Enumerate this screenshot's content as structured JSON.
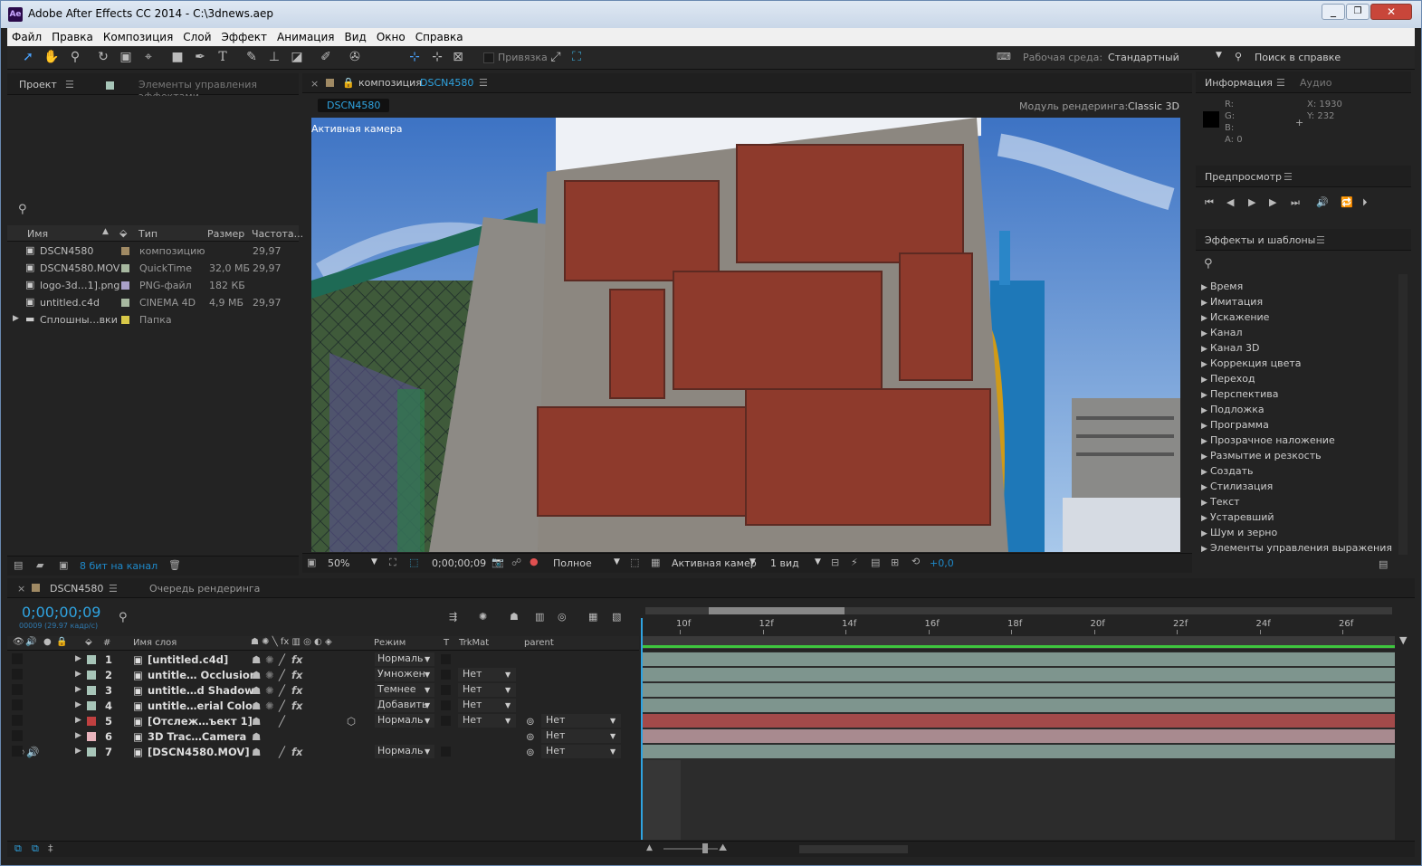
{
  "app": {
    "title": "Adobe After Effects CC 2014 - C:\\3dnews.aep",
    "logo": "Ae"
  },
  "menu": [
    "Файл",
    "Правка",
    "Композиция",
    "Слой",
    "Эффект",
    "Анимация",
    "Вид",
    "Окно",
    "Справка"
  ],
  "toolbar": {
    "snap_label": "Привязка",
    "workspace_label": "Рабочая среда:",
    "workspace_value": "Стандартный",
    "help_search": "Поиск в справке"
  },
  "project": {
    "tab": "Проект",
    "tab2": "Элементы управления эффектами",
    "columns": [
      "Имя",
      "Тип",
      "Размер",
      "Частота..."
    ],
    "items": [
      {
        "name": "DSCN4580",
        "type": "композицию",
        "size": "",
        "rate": "29,97",
        "color": "#a08a64"
      },
      {
        "name": "DSCN4580.MOV",
        "type": "QuickTime",
        "size": "32,0 МБ",
        "rate": "29,97",
        "color": "#a7b8a0"
      },
      {
        "name": "logo-3d…1].png",
        "type": "PNG-файл",
        "size": "182 КБ",
        "rate": "",
        "color": "#a8a0c8"
      },
      {
        "name": "untitled.c4d",
        "type": "CINEMA 4D",
        "size": "4,9 МБ",
        "rate": "29,97",
        "color": "#a7b8a0"
      },
      {
        "name": "Сплошны…вки",
        "type": "Папка",
        "size": "",
        "rate": "",
        "color": "#d8c848"
      }
    ],
    "bpc": "8 бит на канал"
  },
  "comp": {
    "tab_prefix": "композиция",
    "tab_name": "DSCN4580",
    "flow": "DSCN4580",
    "renderer_label": "Модуль рендеринга:",
    "renderer": "Classic 3D",
    "camera_label": "Активная камера",
    "zoom": "50%",
    "timecode": "0;00;00;09",
    "resolution": "Полное",
    "view": "Активная камер",
    "views": "1 вид",
    "exposure": "+0,0"
  },
  "info": {
    "tab": "Информация",
    "tab2": "Аудио",
    "r": "R:",
    "g": "G:",
    "b": "B:",
    "a": "A:  0",
    "x": "X:  1930",
    "y": "Y:  232"
  },
  "preview": {
    "tab": "Предпросмотр"
  },
  "effects": {
    "tab": "Эффекты и шаблоны",
    "items": [
      "Время",
      "Имитация",
      "Искажение",
      "Канал",
      "Канал 3D",
      "Коррекция цвета",
      "Переход",
      "Перспектива",
      "Подложка",
      "Программа",
      "Прозрачное наложение",
      "Размытие и резкость",
      "Создать",
      "Стилизация",
      "Текст",
      "Устаревший",
      "Шум и зерно",
      "Элементы управления выражения"
    ]
  },
  "timeline": {
    "tab": "DSCN4580",
    "tab2": "Очередь рендеринга",
    "timecode": "0;00;00;09",
    "fps": "00009 (29.97 кадр/с)",
    "cols": {
      "num": "#",
      "name": "Имя слоя",
      "mode": "Режим",
      "t": "T",
      "trkmat": "TrkMat",
      "parent": "parent"
    },
    "ruler": [
      "10f",
      "12f",
      "14f",
      "16f",
      "18f",
      "20f",
      "22f",
      "24f",
      "26f"
    ],
    "layers": [
      {
        "num": "1",
        "name": "[untitled.c4d]",
        "mode": "Нормаль",
        "trk": "",
        "parent": "",
        "color": "#a7c5b8",
        "bar": "#7e958e"
      },
      {
        "num": "2",
        "name": "untitle… Occlusion",
        "mode": "Умножен",
        "trk": "Нет",
        "parent": "",
        "color": "#a7c5b8",
        "bar": "#7e958e"
      },
      {
        "num": "3",
        "name": "untitle…d Shadow",
        "mode": "Темнее",
        "trk": "Нет",
        "parent": "",
        "color": "#a7c5b8",
        "bar": "#7e958e"
      },
      {
        "num": "4",
        "name": "untitle…erial Color",
        "mode": "Добавить",
        "trk": "Нет",
        "parent": "",
        "color": "#a7c5b8",
        "bar": "#7e958e"
      },
      {
        "num": "5",
        "name": "[Отслеж…ъект 1]",
        "mode": "Нормаль",
        "trk": "Нет",
        "parent": "Нет",
        "color": "#c04040",
        "bar": "#a34a4a"
      },
      {
        "num": "6",
        "name": "3D Trac…Camera",
        "mode": "",
        "trk": "",
        "parent": "Нет",
        "color": "#e8b4bc",
        "bar": "#a88a8f"
      },
      {
        "num": "7",
        "name": "[DSCN4580.MOV]",
        "mode": "Нормаль",
        "trk": "",
        "parent": "Нет",
        "color": "#a7c5b8",
        "bar": "#7e958e"
      }
    ]
  }
}
